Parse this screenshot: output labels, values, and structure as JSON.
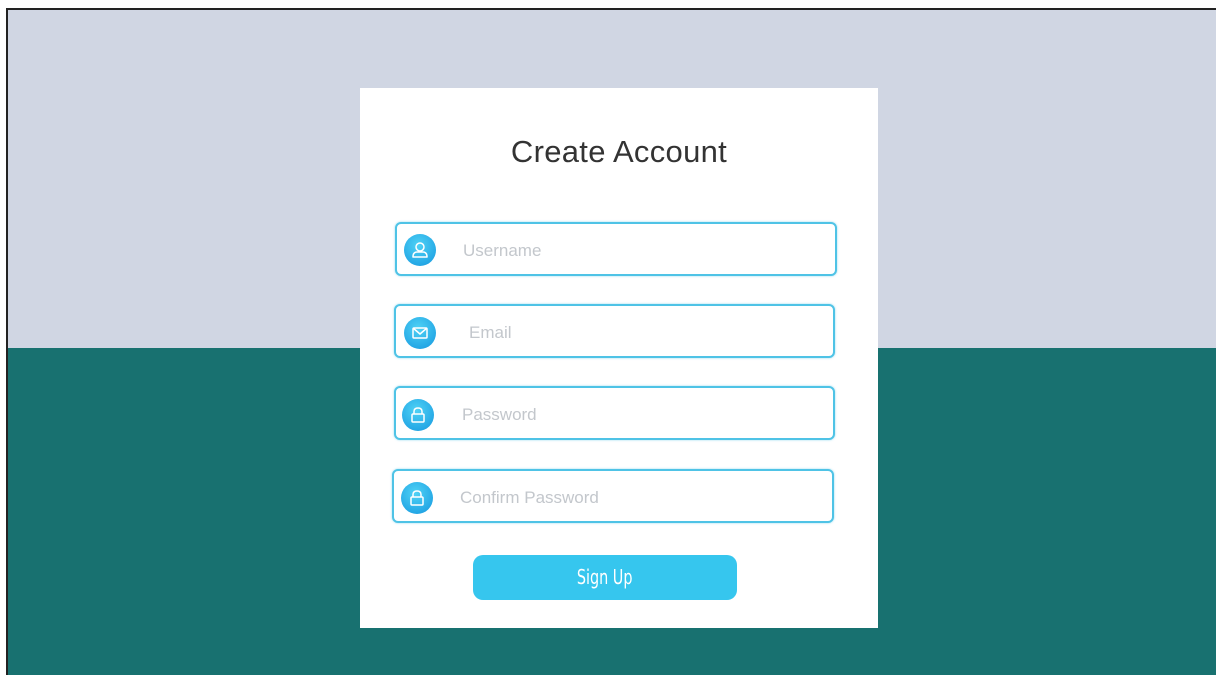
{
  "form": {
    "title": "Create Account",
    "fields": [
      {
        "placeholder": "Username",
        "icon": "user-icon"
      },
      {
        "placeholder": "Email",
        "icon": "mail-icon"
      },
      {
        "placeholder": "Password",
        "icon": "lock-icon"
      },
      {
        "placeholder": "Confirm Password",
        "icon": "lock-icon"
      }
    ],
    "submit_label": "Sign Up"
  },
  "colors": {
    "background_top": "#d0d6e3",
    "background_bottom": "#187170",
    "card": "#ffffff",
    "field_border": "#4fc3e6",
    "icon_fill": "#26a9e6",
    "button": "#36c6ee",
    "placeholder_text": "#c3c7cc",
    "title_text": "#333333"
  }
}
